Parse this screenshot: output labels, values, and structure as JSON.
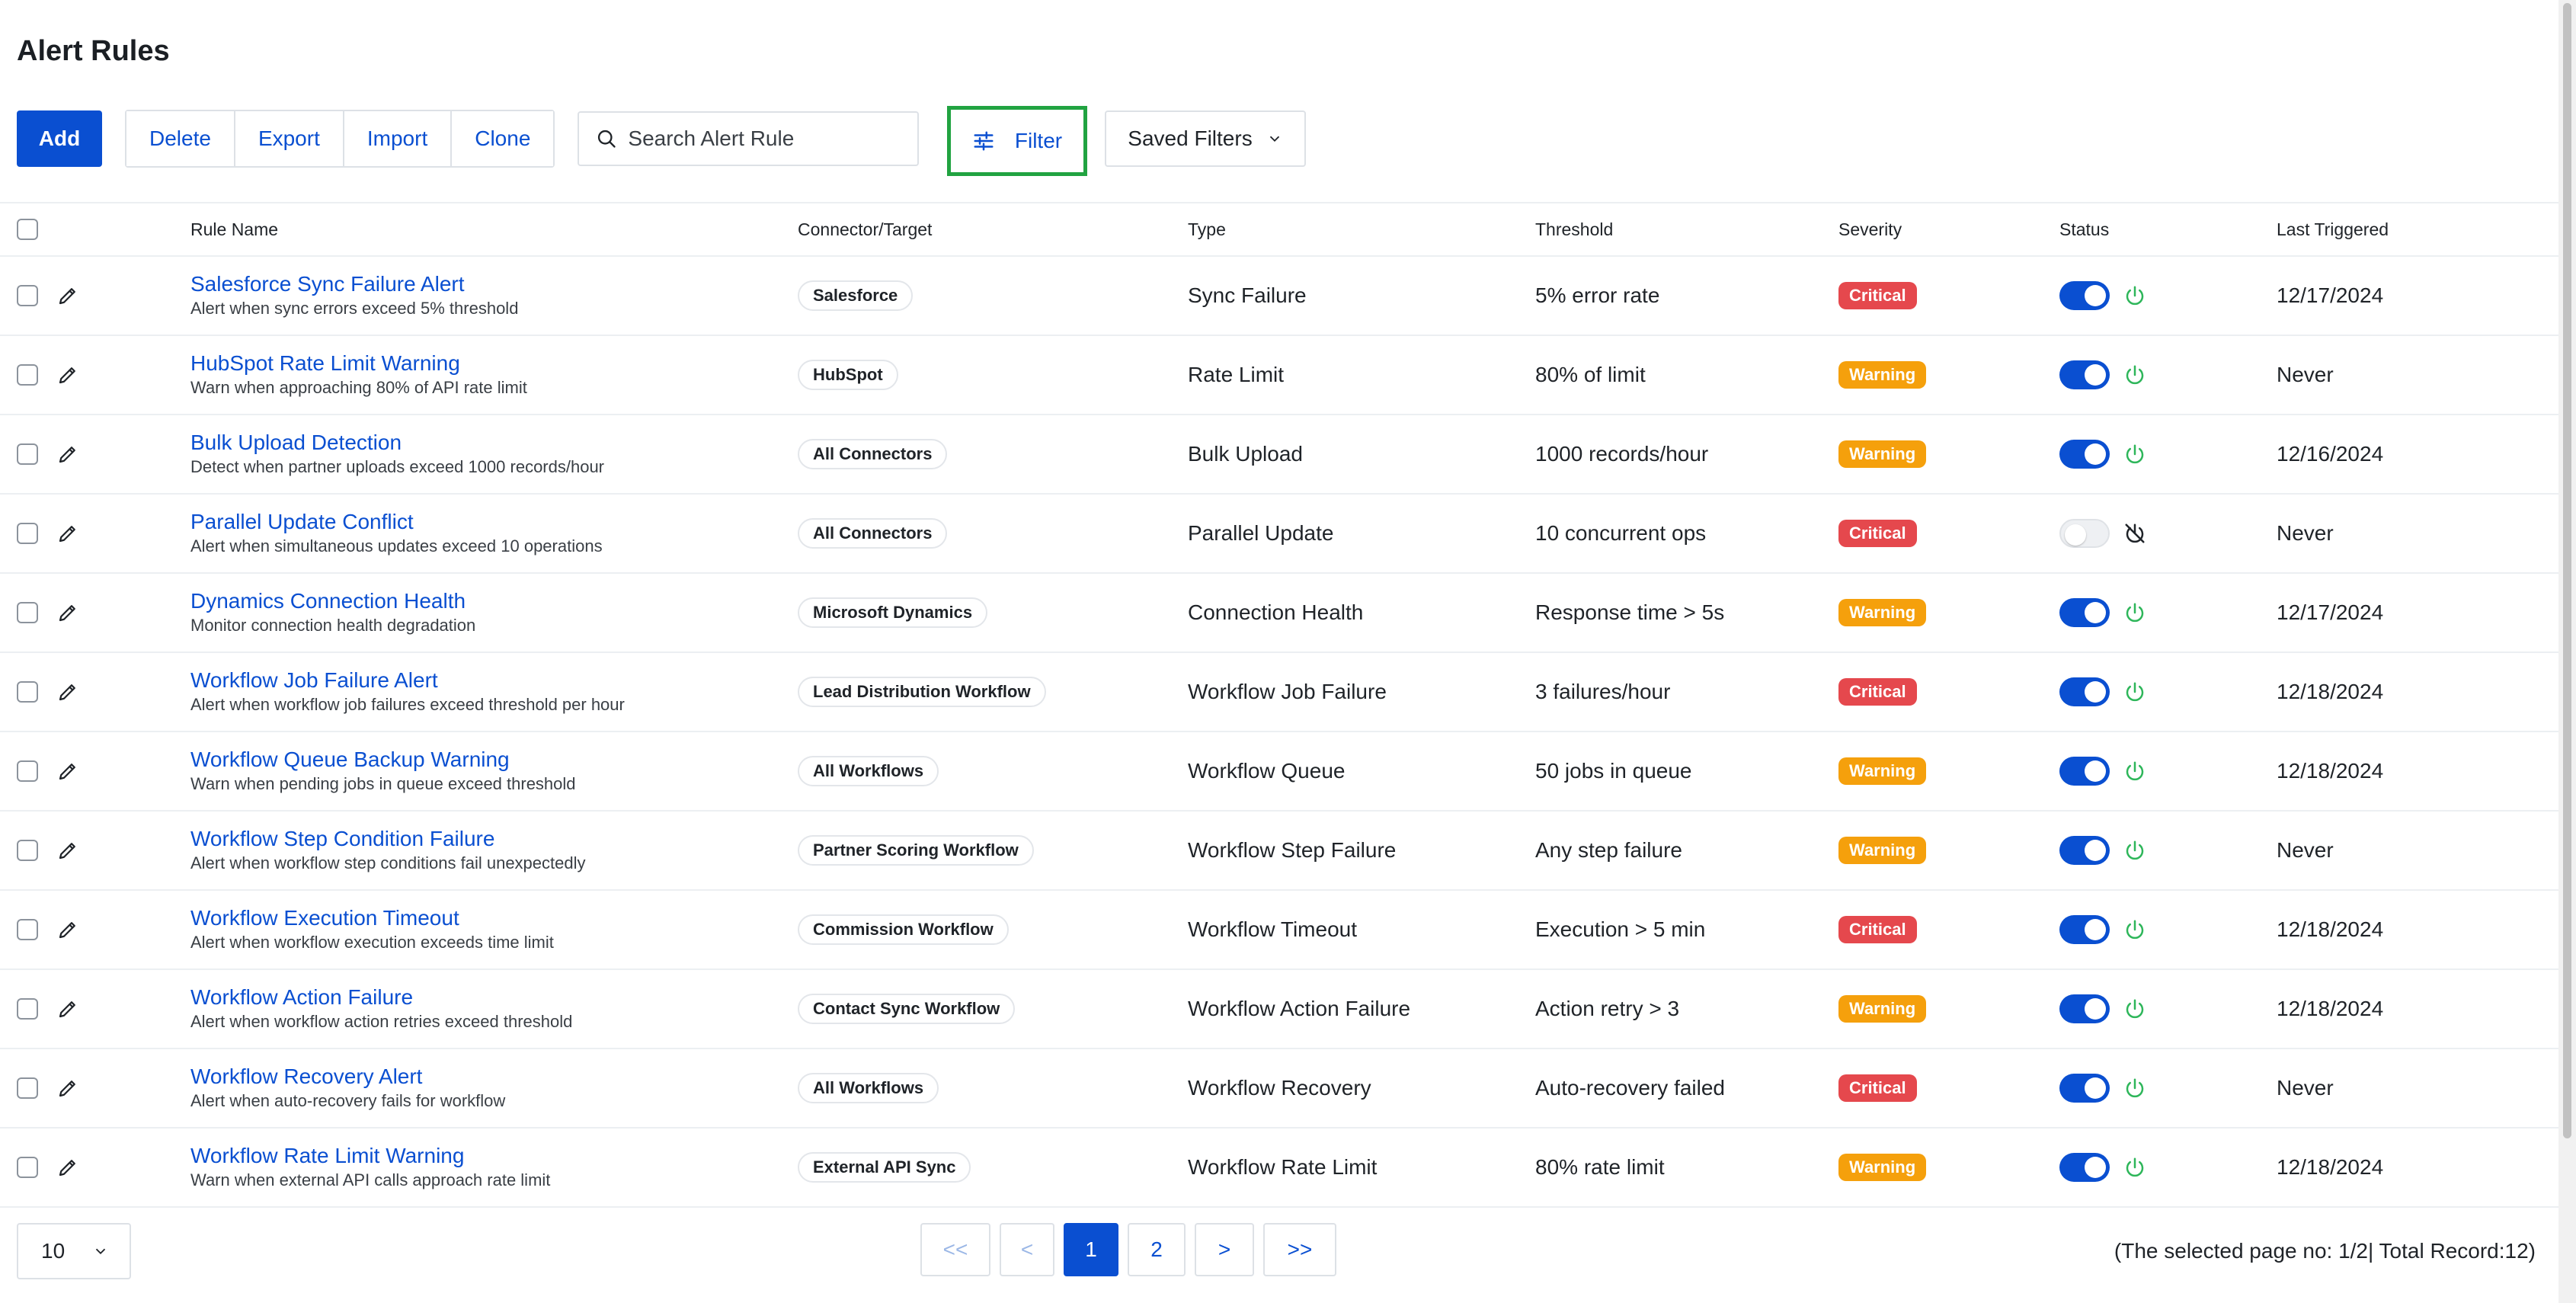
{
  "page": {
    "title": "Alert Rules"
  },
  "toolbar": {
    "add_label": "Add",
    "delete_label": "Delete",
    "export_label": "Export",
    "import_label": "Import",
    "clone_label": "Clone",
    "search_placeholder": "Search Alert Rule",
    "filter_label": "Filter",
    "saved_filters_label": "Saved Filters"
  },
  "table": {
    "columns": [
      "Rule Name",
      "Connector/Target",
      "Type",
      "Threshold",
      "Severity",
      "Status",
      "Last Triggered"
    ],
    "rows": [
      {
        "name": "Salesforce Sync Failure Alert",
        "desc": "Alert when sync errors exceed 5% threshold",
        "target": "Salesforce",
        "type": "Sync Failure",
        "threshold": "5% error rate",
        "severity": "Critical",
        "enabled": true,
        "last": "12/17/2024"
      },
      {
        "name": "HubSpot Rate Limit Warning",
        "desc": "Warn when approaching 80% of API rate limit",
        "target": "HubSpot",
        "type": "Rate Limit",
        "threshold": "80% of limit",
        "severity": "Warning",
        "enabled": true,
        "last": "Never"
      },
      {
        "name": "Bulk Upload Detection",
        "desc": "Detect when partner uploads exceed 1000 records/hour",
        "target": "All Connectors",
        "type": "Bulk Upload",
        "threshold": "1000 records/hour",
        "severity": "Warning",
        "enabled": true,
        "last": "12/16/2024"
      },
      {
        "name": "Parallel Update Conflict",
        "desc": "Alert when simultaneous updates exceed 10 operations",
        "target": "All Connectors",
        "type": "Parallel Update",
        "threshold": "10 concurrent ops",
        "severity": "Critical",
        "enabled": false,
        "last": "Never"
      },
      {
        "name": "Dynamics Connection Health",
        "desc": "Monitor connection health degradation",
        "target": "Microsoft Dynamics",
        "type": "Connection Health",
        "threshold": "Response time > 5s",
        "severity": "Warning",
        "enabled": true,
        "last": "12/17/2024"
      },
      {
        "name": "Workflow Job Failure Alert",
        "desc": "Alert when workflow job failures exceed threshold per hour",
        "target": "Lead Distribution Workflow",
        "type": "Workflow Job Failure",
        "threshold": "3 failures/hour",
        "severity": "Critical",
        "enabled": true,
        "last": "12/18/2024"
      },
      {
        "name": "Workflow Queue Backup Warning",
        "desc": "Warn when pending jobs in queue exceed threshold",
        "target": "All Workflows",
        "type": "Workflow Queue",
        "threshold": "50 jobs in queue",
        "severity": "Warning",
        "enabled": true,
        "last": "12/18/2024"
      },
      {
        "name": "Workflow Step Condition Failure",
        "desc": "Alert when workflow step conditions fail unexpectedly",
        "target": "Partner Scoring Workflow",
        "type": "Workflow Step Failure",
        "threshold": "Any step failure",
        "severity": "Warning",
        "enabled": true,
        "last": "Never"
      },
      {
        "name": "Workflow Execution Timeout",
        "desc": "Alert when workflow execution exceeds time limit",
        "target": "Commission Workflow",
        "type": "Workflow Timeout",
        "threshold": "Execution > 5 min",
        "severity": "Critical",
        "enabled": true,
        "last": "12/18/2024"
      },
      {
        "name": "Workflow Action Failure",
        "desc": "Alert when workflow action retries exceed threshold",
        "target": "Contact Sync Workflow",
        "type": "Workflow Action Failure",
        "threshold": "Action retry > 3",
        "severity": "Warning",
        "enabled": true,
        "last": "12/18/2024"
      },
      {
        "name": "Workflow Recovery Alert",
        "desc": "Alert when auto-recovery fails for workflow",
        "target": "All Workflows",
        "type": "Workflow Recovery",
        "threshold": "Auto-recovery failed",
        "severity": "Critical",
        "enabled": true,
        "last": "Never"
      },
      {
        "name": "Workflow Rate Limit Warning",
        "desc": "Warn when external API calls approach rate limit",
        "target": "External API Sync",
        "type": "Workflow Rate Limit",
        "threshold": "80% rate limit",
        "severity": "Warning",
        "enabled": true,
        "last": "12/18/2024"
      }
    ]
  },
  "pagination": {
    "page_size": "10",
    "first_label": "<<",
    "prev_label": "<",
    "pages": [
      "1",
      "2"
    ],
    "current_page": "1",
    "next_label": ">",
    "last_label": ">>",
    "info": "(The selected page no: 1/2| Total Record:12)"
  },
  "colors": {
    "primary": "#0a4fd1",
    "critical": "#e5484d",
    "warning": "#f5a00c",
    "power_on": "#2eb65a",
    "filter_highlight": "#21a341"
  },
  "icons": {
    "search": "search-icon",
    "filter": "sliders-icon",
    "dropdown": "chevron-down-icon",
    "edit": "pencil-icon",
    "status_on": "power-icon",
    "status_off": "power-off-icon"
  }
}
